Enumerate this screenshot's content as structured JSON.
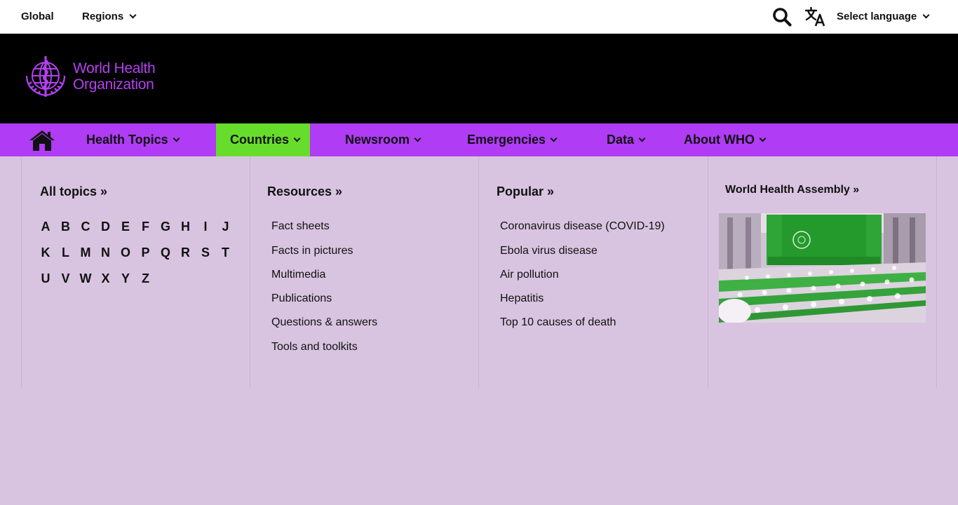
{
  "topbar": {
    "global_label": "Global",
    "regions_label": "Regions",
    "language_label": "Select language"
  },
  "header": {
    "logo_line1": "World Health",
    "logo_line2": "Organization"
  },
  "nav": {
    "items": [
      {
        "label": "Health Topics"
      },
      {
        "label": "Countries"
      },
      {
        "label": "Newsroom"
      },
      {
        "label": "Emergencies"
      },
      {
        "label": "Data"
      },
      {
        "label": "About WHO"
      }
    ],
    "active_index": 1
  },
  "panel": {
    "all_topics": {
      "title": "All topics »",
      "letters": [
        "A",
        "B",
        "C",
        "D",
        "E",
        "F",
        "G",
        "H",
        "I",
        "J",
        "K",
        "L",
        "M",
        "N",
        "O",
        "P",
        "Q",
        "R",
        "S",
        "T",
        "U",
        "V",
        "W",
        "X",
        "Y",
        "Z"
      ]
    },
    "resources": {
      "title": "Resources »",
      "links": [
        "Fact sheets",
        "Facts in pictures",
        "Multimedia",
        "Publications",
        "Questions & answers",
        "Tools and toolkits"
      ]
    },
    "popular": {
      "title": "Popular »",
      "links": [
        "Coronavirus disease (COVID-19)",
        "Ebola virus disease",
        "Air pollution",
        "Hepatitis",
        "Top 10 causes of death"
      ]
    },
    "feature": {
      "title": "World Health Assembly »"
    }
  },
  "colors": {
    "nav_bg": "#b03cf5",
    "nav_active": "#66dd2a",
    "header_bg": "#000000",
    "panel_bg": "#d8c4e0",
    "logo_purple": "#b440f0"
  }
}
